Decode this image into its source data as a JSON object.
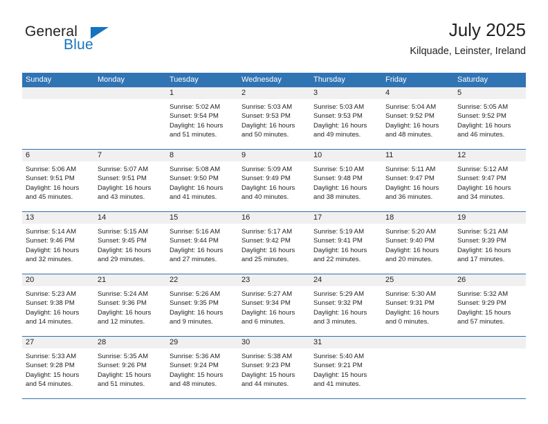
{
  "brand": {
    "word1": "General",
    "word2": "Blue",
    "accent_color": "#1673be"
  },
  "header": {
    "title": "July 2025",
    "subtitle": "Kilquade, Leinster, Ireland"
  },
  "theme": {
    "header_blue": "#3174b4",
    "separator_blue": "#2f6fb0",
    "day_band_gray": "#f0f0f0"
  },
  "weekdays": [
    "Sunday",
    "Monday",
    "Tuesday",
    "Wednesday",
    "Thursday",
    "Friday",
    "Saturday"
  ],
  "weeks": [
    [
      {
        "day": "",
        "empty": true
      },
      {
        "day": "",
        "empty": true
      },
      {
        "day": "1",
        "sunrise": "Sunrise: 5:02 AM",
        "sunset": "Sunset: 9:54 PM",
        "daylight1": "Daylight: 16 hours",
        "daylight2": "and 51 minutes."
      },
      {
        "day": "2",
        "sunrise": "Sunrise: 5:03 AM",
        "sunset": "Sunset: 9:53 PM",
        "daylight1": "Daylight: 16 hours",
        "daylight2": "and 50 minutes."
      },
      {
        "day": "3",
        "sunrise": "Sunrise: 5:03 AM",
        "sunset": "Sunset: 9:53 PM",
        "daylight1": "Daylight: 16 hours",
        "daylight2": "and 49 minutes."
      },
      {
        "day": "4",
        "sunrise": "Sunrise: 5:04 AM",
        "sunset": "Sunset: 9:52 PM",
        "daylight1": "Daylight: 16 hours",
        "daylight2": "and 48 minutes."
      },
      {
        "day": "5",
        "sunrise": "Sunrise: 5:05 AM",
        "sunset": "Sunset: 9:52 PM",
        "daylight1": "Daylight: 16 hours",
        "daylight2": "and 46 minutes."
      }
    ],
    [
      {
        "day": "6",
        "sunrise": "Sunrise: 5:06 AM",
        "sunset": "Sunset: 9:51 PM",
        "daylight1": "Daylight: 16 hours",
        "daylight2": "and 45 minutes."
      },
      {
        "day": "7",
        "sunrise": "Sunrise: 5:07 AM",
        "sunset": "Sunset: 9:51 PM",
        "daylight1": "Daylight: 16 hours",
        "daylight2": "and 43 minutes."
      },
      {
        "day": "8",
        "sunrise": "Sunrise: 5:08 AM",
        "sunset": "Sunset: 9:50 PM",
        "daylight1": "Daylight: 16 hours",
        "daylight2": "and 41 minutes."
      },
      {
        "day": "9",
        "sunrise": "Sunrise: 5:09 AM",
        "sunset": "Sunset: 9:49 PM",
        "daylight1": "Daylight: 16 hours",
        "daylight2": "and 40 minutes."
      },
      {
        "day": "10",
        "sunrise": "Sunrise: 5:10 AM",
        "sunset": "Sunset: 9:48 PM",
        "daylight1": "Daylight: 16 hours",
        "daylight2": "and 38 minutes."
      },
      {
        "day": "11",
        "sunrise": "Sunrise: 5:11 AM",
        "sunset": "Sunset: 9:47 PM",
        "daylight1": "Daylight: 16 hours",
        "daylight2": "and 36 minutes."
      },
      {
        "day": "12",
        "sunrise": "Sunrise: 5:12 AM",
        "sunset": "Sunset: 9:47 PM",
        "daylight1": "Daylight: 16 hours",
        "daylight2": "and 34 minutes."
      }
    ],
    [
      {
        "day": "13",
        "sunrise": "Sunrise: 5:14 AM",
        "sunset": "Sunset: 9:46 PM",
        "daylight1": "Daylight: 16 hours",
        "daylight2": "and 32 minutes."
      },
      {
        "day": "14",
        "sunrise": "Sunrise: 5:15 AM",
        "sunset": "Sunset: 9:45 PM",
        "daylight1": "Daylight: 16 hours",
        "daylight2": "and 29 minutes."
      },
      {
        "day": "15",
        "sunrise": "Sunrise: 5:16 AM",
        "sunset": "Sunset: 9:44 PM",
        "daylight1": "Daylight: 16 hours",
        "daylight2": "and 27 minutes."
      },
      {
        "day": "16",
        "sunrise": "Sunrise: 5:17 AM",
        "sunset": "Sunset: 9:42 PM",
        "daylight1": "Daylight: 16 hours",
        "daylight2": "and 25 minutes."
      },
      {
        "day": "17",
        "sunrise": "Sunrise: 5:19 AM",
        "sunset": "Sunset: 9:41 PM",
        "daylight1": "Daylight: 16 hours",
        "daylight2": "and 22 minutes."
      },
      {
        "day": "18",
        "sunrise": "Sunrise: 5:20 AM",
        "sunset": "Sunset: 9:40 PM",
        "daylight1": "Daylight: 16 hours",
        "daylight2": "and 20 minutes."
      },
      {
        "day": "19",
        "sunrise": "Sunrise: 5:21 AM",
        "sunset": "Sunset: 9:39 PM",
        "daylight1": "Daylight: 16 hours",
        "daylight2": "and 17 minutes."
      }
    ],
    [
      {
        "day": "20",
        "sunrise": "Sunrise: 5:23 AM",
        "sunset": "Sunset: 9:38 PM",
        "daylight1": "Daylight: 16 hours",
        "daylight2": "and 14 minutes."
      },
      {
        "day": "21",
        "sunrise": "Sunrise: 5:24 AM",
        "sunset": "Sunset: 9:36 PM",
        "daylight1": "Daylight: 16 hours",
        "daylight2": "and 12 minutes."
      },
      {
        "day": "22",
        "sunrise": "Sunrise: 5:26 AM",
        "sunset": "Sunset: 9:35 PM",
        "daylight1": "Daylight: 16 hours",
        "daylight2": "and 9 minutes."
      },
      {
        "day": "23",
        "sunrise": "Sunrise: 5:27 AM",
        "sunset": "Sunset: 9:34 PM",
        "daylight1": "Daylight: 16 hours",
        "daylight2": "and 6 minutes."
      },
      {
        "day": "24",
        "sunrise": "Sunrise: 5:29 AM",
        "sunset": "Sunset: 9:32 PM",
        "daylight1": "Daylight: 16 hours",
        "daylight2": "and 3 minutes."
      },
      {
        "day": "25",
        "sunrise": "Sunrise: 5:30 AM",
        "sunset": "Sunset: 9:31 PM",
        "daylight1": "Daylight: 16 hours",
        "daylight2": "and 0 minutes."
      },
      {
        "day": "26",
        "sunrise": "Sunrise: 5:32 AM",
        "sunset": "Sunset: 9:29 PM",
        "daylight1": "Daylight: 15 hours",
        "daylight2": "and 57 minutes."
      }
    ],
    [
      {
        "day": "27",
        "sunrise": "Sunrise: 5:33 AM",
        "sunset": "Sunset: 9:28 PM",
        "daylight1": "Daylight: 15 hours",
        "daylight2": "and 54 minutes."
      },
      {
        "day": "28",
        "sunrise": "Sunrise: 5:35 AM",
        "sunset": "Sunset: 9:26 PM",
        "daylight1": "Daylight: 15 hours",
        "daylight2": "and 51 minutes."
      },
      {
        "day": "29",
        "sunrise": "Sunrise: 5:36 AM",
        "sunset": "Sunset: 9:24 PM",
        "daylight1": "Daylight: 15 hours",
        "daylight2": "and 48 minutes."
      },
      {
        "day": "30",
        "sunrise": "Sunrise: 5:38 AM",
        "sunset": "Sunset: 9:23 PM",
        "daylight1": "Daylight: 15 hours",
        "daylight2": "and 44 minutes."
      },
      {
        "day": "31",
        "sunrise": "Sunrise: 5:40 AM",
        "sunset": "Sunset: 9:21 PM",
        "daylight1": "Daylight: 15 hours",
        "daylight2": "and 41 minutes."
      },
      {
        "day": "",
        "empty": true
      },
      {
        "day": "",
        "empty": true
      }
    ]
  ]
}
